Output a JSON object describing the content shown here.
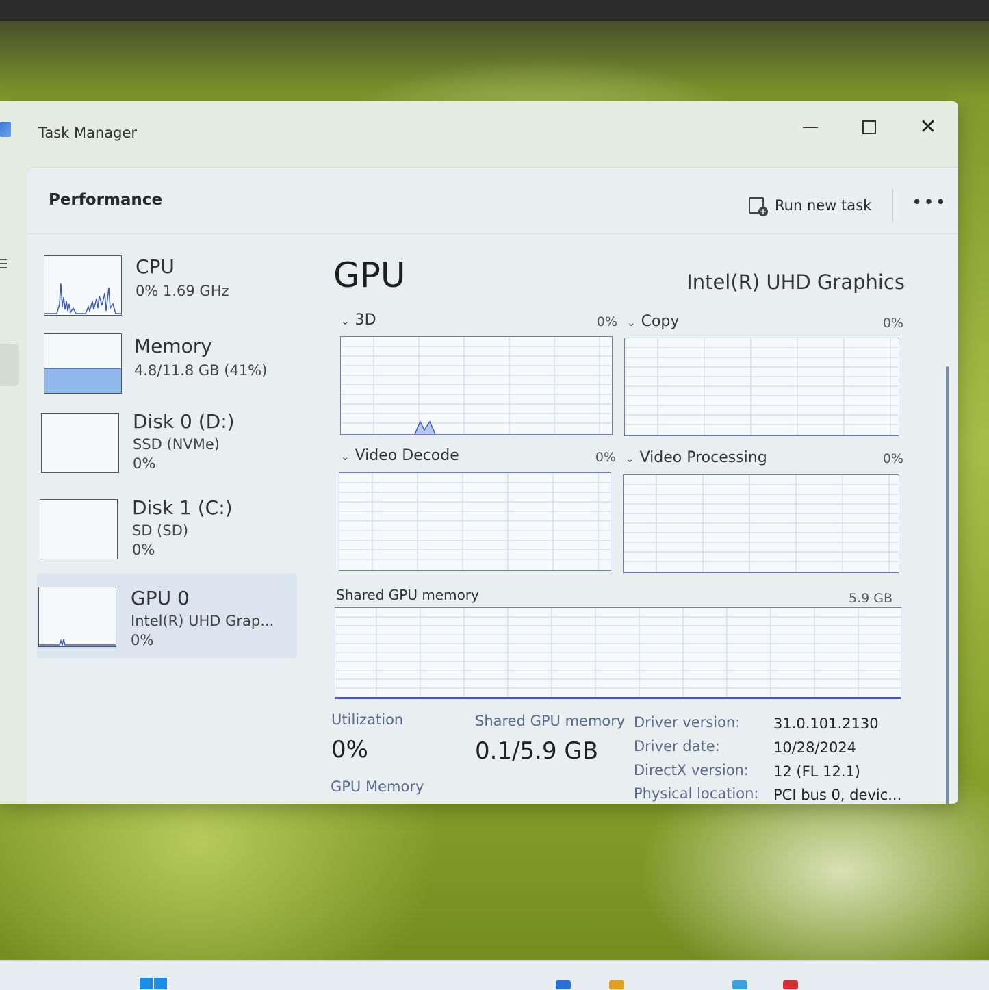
{
  "window": {
    "title": "Task Manager"
  },
  "header": {
    "page_title": "Performance",
    "run_task_label": "Run new task",
    "more_label": "•••"
  },
  "devices": [
    {
      "name": "CPU",
      "line1": "0% 1.69 GHz",
      "line2": ""
    },
    {
      "name": "Memory",
      "line1": "4.8/11.8 GB (41%)",
      "line2": ""
    },
    {
      "name": "Disk 0 (D:)",
      "line1": "SSD (NVMe)",
      "line2": "0%"
    },
    {
      "name": "Disk 1 (C:)",
      "line1": "SD (SD)",
      "line2": "0%"
    },
    {
      "name": "GPU 0",
      "line1": "Intel(R) UHD Grap...",
      "line2": "0%"
    }
  ],
  "gpu": {
    "title": "GPU",
    "model": "Intel(R) UHD Graphics",
    "engines": [
      {
        "name": "3D",
        "percent": "0%"
      },
      {
        "name": "Copy",
        "percent": "0%"
      },
      {
        "name": "Video Decode",
        "percent": "0%"
      },
      {
        "name": "Video Processing",
        "percent": "0%"
      }
    ],
    "shared_memory_graph": {
      "label": "Shared GPU memory",
      "max": "5.9 GB"
    },
    "stats": {
      "utilization_label": "Utilization",
      "utilization_value": "0%",
      "shared_label": "Shared GPU memory",
      "shared_value": "0.1/5.9 GB",
      "gpu_memory_label": "GPU Memory"
    },
    "details": [
      {
        "key": "Driver version:",
        "value": "31.0.101.2130"
      },
      {
        "key": "Driver date:",
        "value": "10/28/2024"
      },
      {
        "key": "DirectX version:",
        "value": "12 (FL 12.1)"
      },
      {
        "key": "Physical location:",
        "value": "PCI bus 0, devic..."
      }
    ]
  },
  "colors": {
    "accent": "#6b7fb0",
    "selection": "#dae5ef",
    "memory_fill": "#8fb9e8"
  }
}
